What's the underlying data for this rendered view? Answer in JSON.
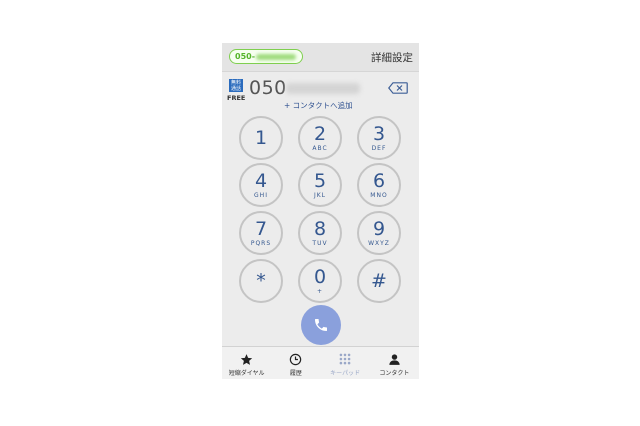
{
  "header": {
    "phone_prefix": "050-",
    "settings_label": "詳細設定"
  },
  "dial": {
    "badge_text": "無料通話",
    "free_label": "FREE",
    "number_prefix": "050",
    "add_contact": "+ コンタクトへ追加"
  },
  "keypad": [
    {
      "digit": "1",
      "letters": ""
    },
    {
      "digit": "2",
      "letters": "ABC"
    },
    {
      "digit": "3",
      "letters": "DEF"
    },
    {
      "digit": "4",
      "letters": "GHI"
    },
    {
      "digit": "5",
      "letters": "JKL"
    },
    {
      "digit": "6",
      "letters": "MNO"
    },
    {
      "digit": "7",
      "letters": "PQRS"
    },
    {
      "digit": "8",
      "letters": "TUV"
    },
    {
      "digit": "9",
      "letters": "WXYZ"
    },
    {
      "digit": "*",
      "letters": ""
    },
    {
      "digit": "0",
      "letters": "+"
    },
    {
      "digit": "#",
      "letters": ""
    }
  ],
  "tabs": [
    {
      "label": "短縮ダイヤル",
      "icon": "star-icon"
    },
    {
      "label": "履歴",
      "icon": "clock-icon"
    },
    {
      "label": "キーパッド",
      "icon": "keypad-icon",
      "active": true
    },
    {
      "label": "コンタクト",
      "icon": "person-icon"
    }
  ],
  "colors": {
    "accent": "#34578f",
    "call_button": "#8aa0dc",
    "pill_green": "#55b52a"
  }
}
